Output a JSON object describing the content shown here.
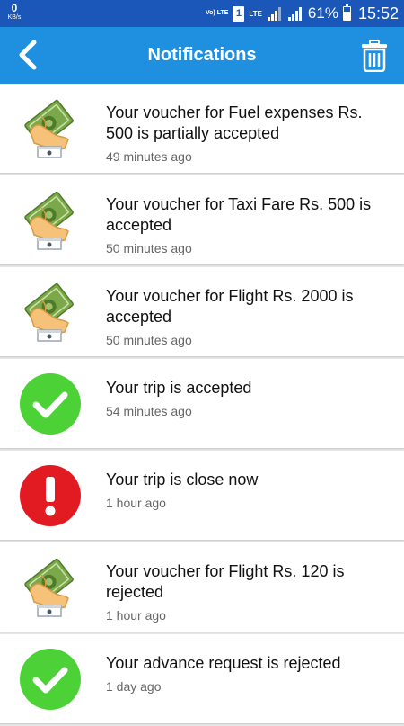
{
  "status_bar": {
    "speed_value": "0",
    "speed_unit": "KB/s",
    "volte": "Vo) LTE",
    "sim_slot": "1",
    "network": "LTE",
    "battery_percent": "61%",
    "battery_level": 0.61,
    "time": "15:52"
  },
  "app_bar": {
    "title": "Notifications",
    "back_icon": "back-chevron-icon",
    "delete_icon": "trash-icon"
  },
  "colors": {
    "status_bar": "#1a57b8",
    "app_bar": "#1f8fe0",
    "success": "#4cd137",
    "error": "#e21b23"
  },
  "notifications": [
    {
      "icon": "money-hand-icon",
      "message": "Your voucher for Fuel expenses Rs. 500 is partially accepted",
      "time": "49 minutes ago"
    },
    {
      "icon": "money-hand-icon",
      "message": "Your voucher for Taxi Fare Rs. 500 is accepted",
      "time": "50 minutes ago"
    },
    {
      "icon": "money-hand-icon",
      "message": "Your voucher for Flight Rs. 2000 is accepted",
      "time": "50 minutes ago"
    },
    {
      "icon": "check-circle-icon",
      "message": "Your trip is accepted",
      "time": "54 minutes ago"
    },
    {
      "icon": "alert-circle-icon",
      "message": "Your trip is close now",
      "time": "1 hour ago"
    },
    {
      "icon": "money-hand-icon",
      "message": "Your voucher for Flight Rs. 120 is rejected",
      "time": "1 hour ago"
    },
    {
      "icon": "check-circle-icon",
      "message": "Your advance request is rejected",
      "time": "1 day ago"
    }
  ]
}
